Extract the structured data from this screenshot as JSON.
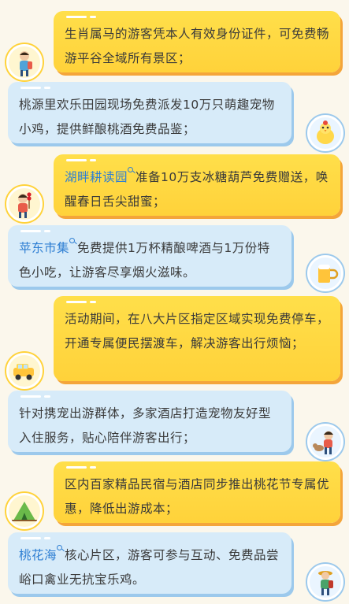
{
  "items": [
    {
      "color": "yellow",
      "text": "生肖属马的游客凭本人有效身份证件，可免费畅游平谷全域所有景区；",
      "highlight": "",
      "icon": "traveler-icon"
    },
    {
      "color": "blue",
      "text": "桃源里欢乐田园现场免费派发10万只萌趣宠物小鸡，提供鲜酿桃酒免费品鉴；",
      "highlight": "",
      "icon": "chick-icon"
    },
    {
      "color": "yellow",
      "highlight": "湖畔耕读园",
      "text": "准备10万支冰糖葫芦免费赠送，唤醒春日舌尖甜蜜；",
      "icon": "child-candy-icon"
    },
    {
      "color": "blue",
      "highlight": "苹东市集",
      "text": "免费提供1万杯精酿啤酒与1万份特色小吃，让游客尽享烟火滋味。",
      "icon": "beer-icon"
    },
    {
      "color": "yellow",
      "text": "活动期间，在八大片区指定区域实现免费停车，开通专属便民摆渡车，解决游客出行烦恼；",
      "highlight": "",
      "icon": "car-icon"
    },
    {
      "color": "blue",
      "text": "针对携宠出游群体，多家酒店打造宠物友好型入住服务，贴心陪伴游客出行；",
      "highlight": "",
      "icon": "pet-owner-icon"
    },
    {
      "color": "yellow",
      "text": "区内百家精品民宿与酒店同步推出桃花节专属优惠，降低出游成本；",
      "highlight": "",
      "icon": "tent-icon"
    },
    {
      "color": "blue",
      "highlight": "桃花海",
      "text": "核心片区，游客可参与互动、免费品尝峪口禽业无抗宝乐鸡。",
      "icon": "hiker-icon"
    }
  ]
}
